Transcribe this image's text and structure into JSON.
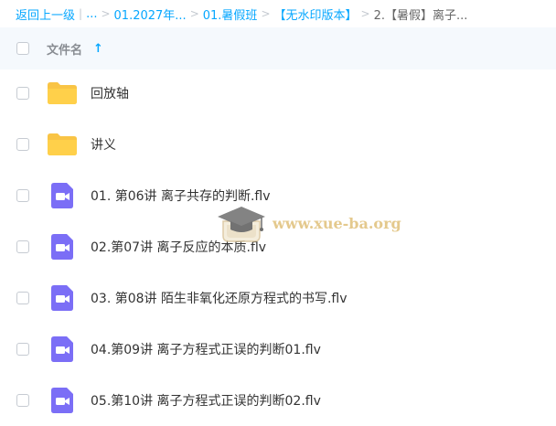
{
  "breadcrumb": {
    "back_label": "返回上一级",
    "bar": "|",
    "ellipsis": "...",
    "items": [
      "01.2027年...",
      "01.暑假班",
      "【无水印版本】",
      "2.【暑假】离子..."
    ],
    "separator": ">"
  },
  "header": {
    "name_label": "文件名",
    "sort_icon": "arrow-up-icon",
    "sort_glyph": "↑"
  },
  "files": [
    {
      "name": "回放轴",
      "type": "folder"
    },
    {
      "name": "讲义",
      "type": "folder"
    },
    {
      "name": "01. 第06讲 离子共存的判断.flv",
      "type": "video"
    },
    {
      "name": "02.第07讲 离子反应的本质.flv",
      "type": "video"
    },
    {
      "name": "03. 第08讲 陌生非氧化还原方程式的书写.flv",
      "type": "video"
    },
    {
      "name": "04.第09讲 离子方程式正误的判断01.flv",
      "type": "video"
    },
    {
      "name": "05.第10讲 离子方程式正误的判断02.flv",
      "type": "video"
    }
  ],
  "watermark": {
    "text": "www.xue-ba.org"
  },
  "colors": {
    "link": "#06a7ff",
    "folder": "#ffd04a",
    "video": "#7b6ef6",
    "header_bg": "#f5f9fd"
  }
}
